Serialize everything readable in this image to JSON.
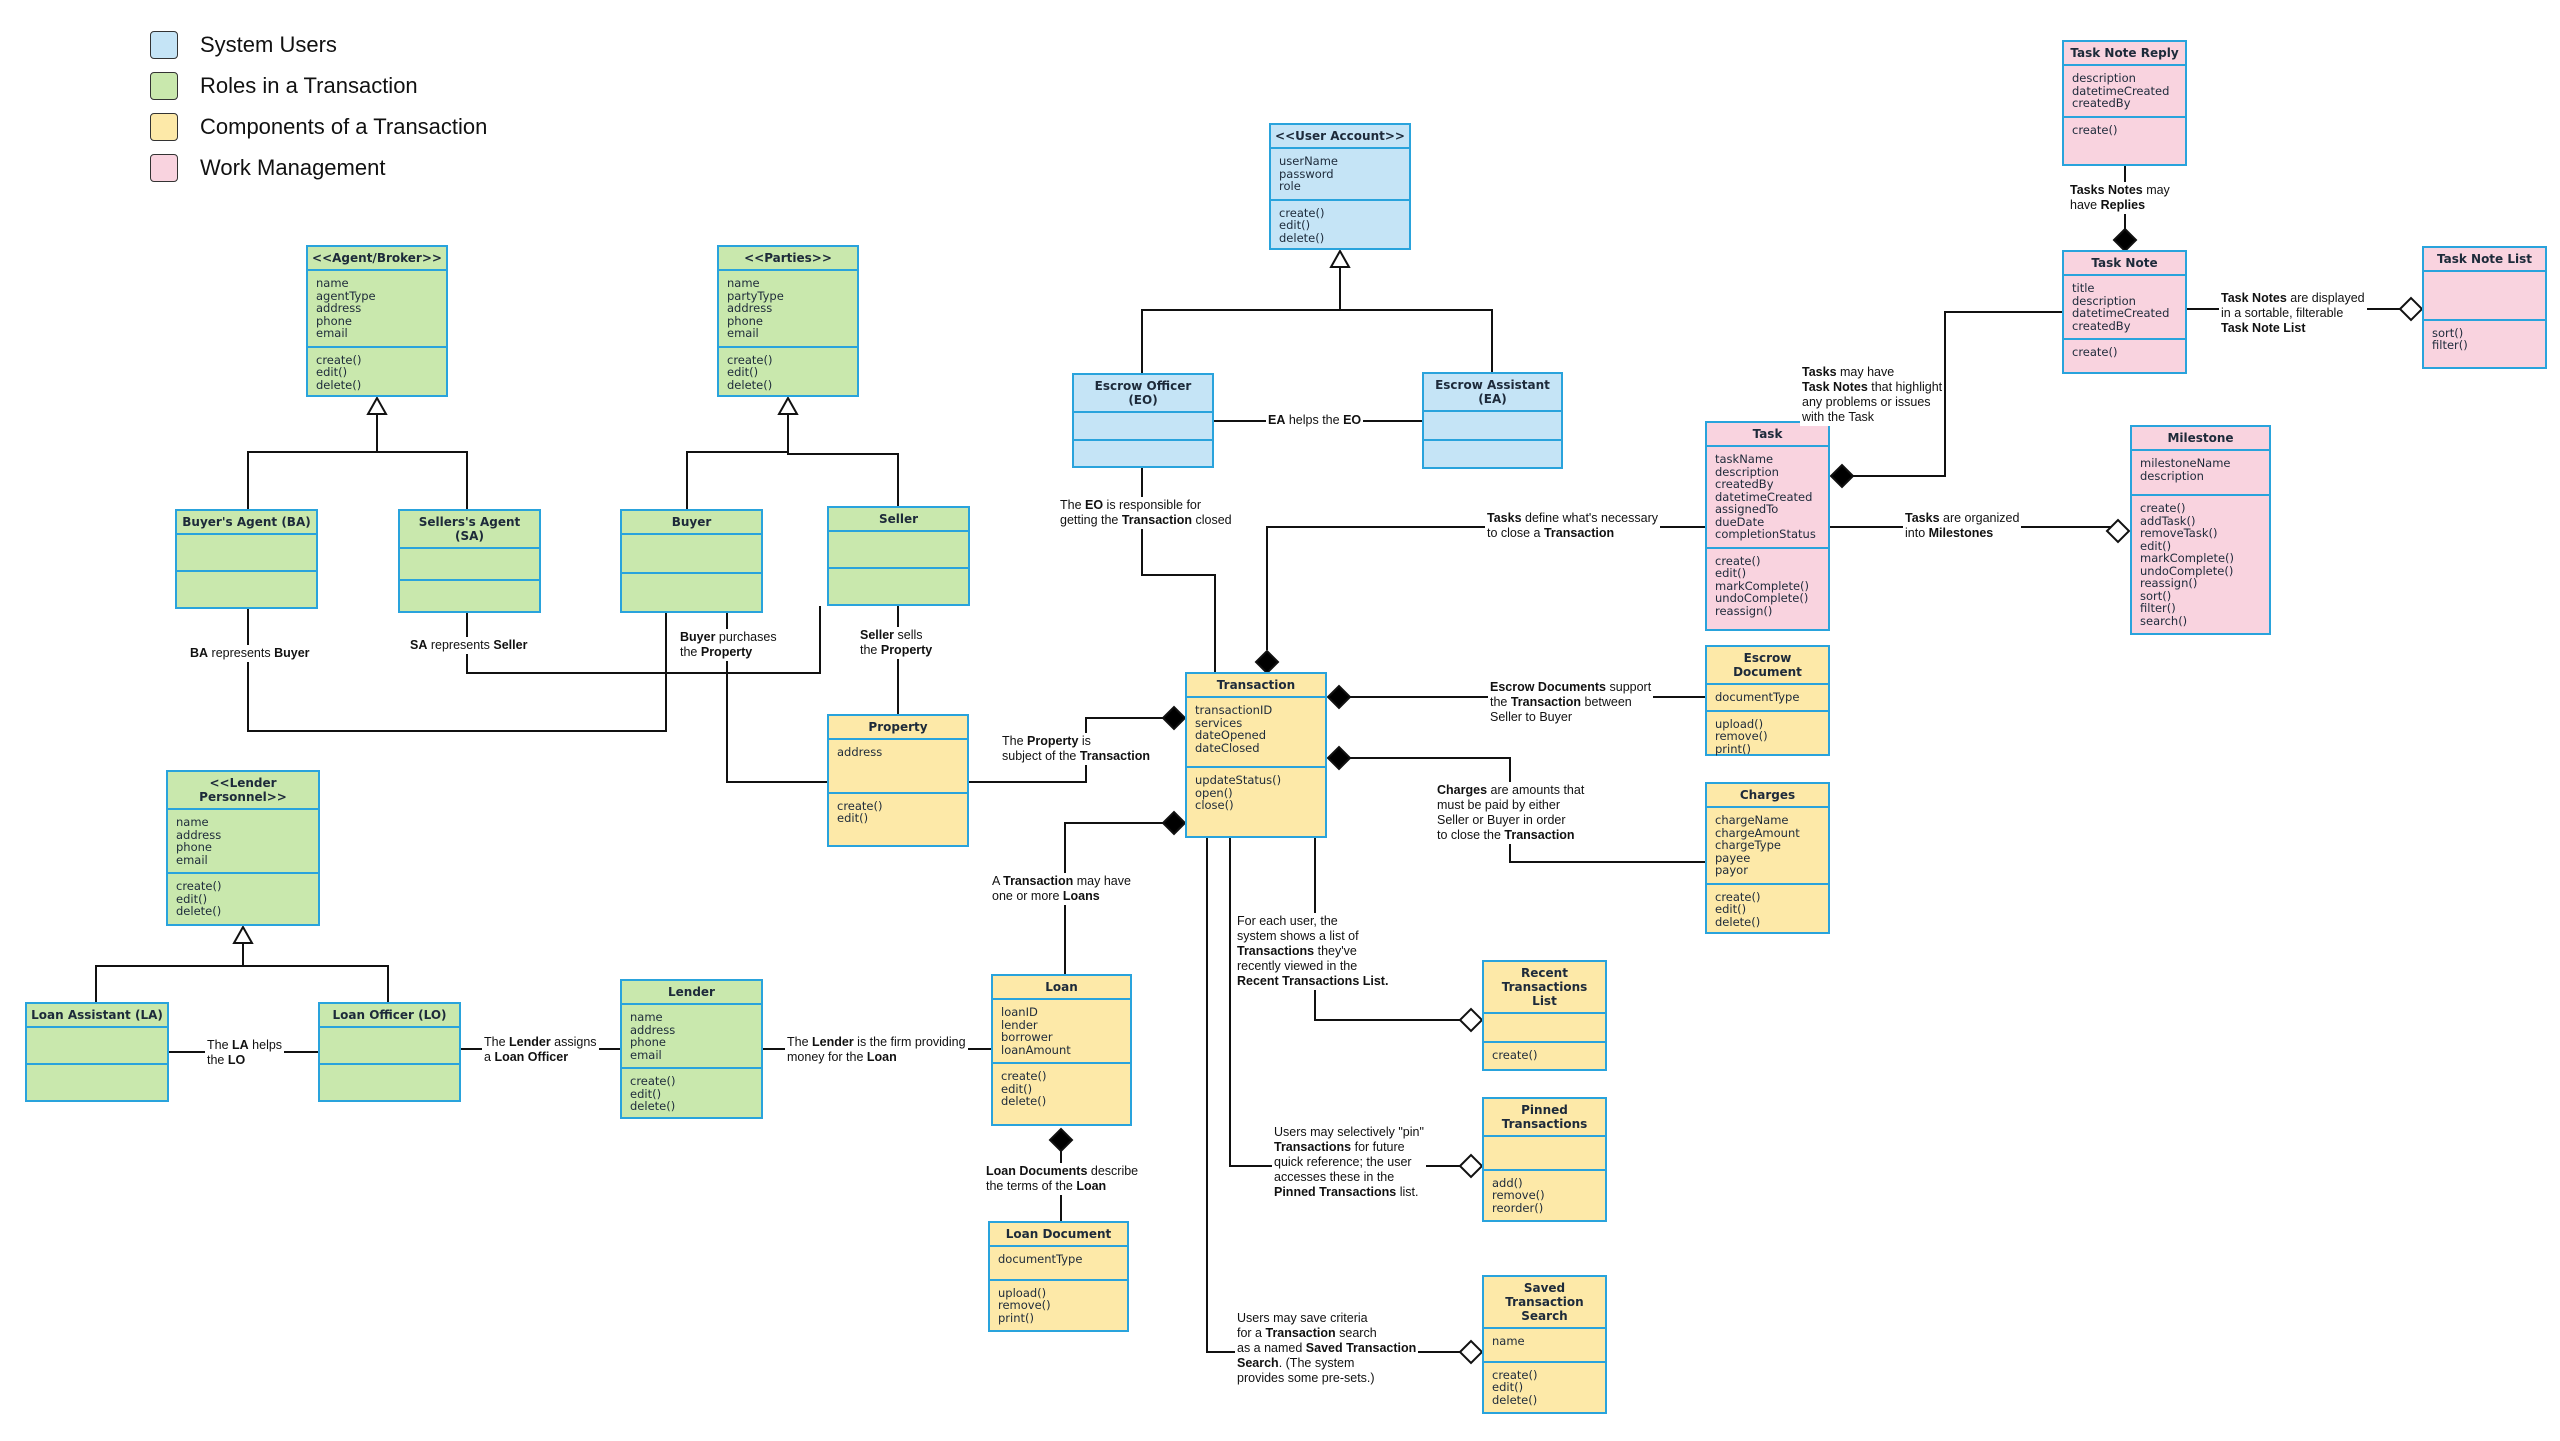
{
  "legend": [
    {
      "label": "System Users",
      "color": "#c5e4f6"
    },
    {
      "label": "Roles in a Transaction",
      "color": "#c9e8ad"
    },
    {
      "label": "Components of a Transaction",
      "color": "#fde9a8"
    },
    {
      "label": "Work Management",
      "color": "#f9d3df"
    }
  ],
  "classes": {
    "agent_broker": {
      "title": "<<Agent/Broker>>",
      "attributes": [
        "name",
        "agentType",
        "address",
        "phone",
        "email"
      ],
      "methods": [
        "create()",
        "edit()",
        "delete()"
      ]
    },
    "parties": {
      "title": "<<Parties>>",
      "attributes": [
        "name",
        "partyType",
        "address",
        "phone",
        "email"
      ],
      "methods": [
        "create()",
        "edit()",
        "delete()"
      ]
    },
    "buyers_agent": {
      "title": "Buyer's Agent (BA)"
    },
    "sellers_agent": {
      "title": "Sellers's Agent (SA)"
    },
    "buyer": {
      "title": "Buyer"
    },
    "seller": {
      "title": "Seller"
    },
    "user_account": {
      "title": "<<User Account>>",
      "attributes": [
        "userName",
        "password",
        "role"
      ],
      "methods": [
        "create()",
        "edit()",
        "delete()"
      ]
    },
    "escrow_officer": {
      "title": "Escrow Officer (EO)"
    },
    "escrow_assistant": {
      "title": "Escrow Assistant (EA)"
    },
    "property": {
      "title": "Property",
      "attributes": [
        "address"
      ],
      "methods": [
        "create()",
        "edit()"
      ]
    },
    "transaction": {
      "title": "Transaction",
      "attributes": [
        "transactionID",
        "services",
        "dateOpened",
        "dateClosed"
      ],
      "methods": [
        "updateStatus()",
        "open()",
        "close()"
      ]
    },
    "lender_personnel": {
      "title": "<<Lender Personnel>>",
      "attributes": [
        "name",
        "address",
        "phone",
        "email"
      ],
      "methods": [
        "create()",
        "edit()",
        "delete()"
      ]
    },
    "loan_assistant": {
      "title": "Loan Assistant (LA)"
    },
    "loan_officer": {
      "title": "Loan Officer (LO)"
    },
    "lender": {
      "title": "Lender",
      "attributes": [
        "name",
        "address",
        "phone",
        "email"
      ],
      "methods": [
        "create()",
        "edit()",
        "delete()"
      ]
    },
    "loan": {
      "title": "Loan",
      "attributes": [
        "loanID",
        "lender",
        "borrower",
        "loanAmount"
      ],
      "methods": [
        "create()",
        "edit()",
        "delete()"
      ]
    },
    "loan_document": {
      "title": "Loan Document",
      "attributes": [
        "documentType"
      ],
      "methods": [
        "upload()",
        "remove()",
        "print()"
      ]
    },
    "escrow_document": {
      "title": "Escrow Document",
      "attributes": [
        "documentType"
      ],
      "methods": [
        "upload()",
        "remove()",
        "print()"
      ]
    },
    "charges": {
      "title": "Charges",
      "attributes": [
        "chargeName",
        "chargeAmount",
        "chargeType",
        "payee",
        "payor"
      ],
      "methods": [
        "create()",
        "edit()",
        "delete()"
      ]
    },
    "recent_transactions_list": {
      "title": "Recent Transactions List",
      "attributes": [],
      "methods": [
        "create()"
      ]
    },
    "pinned_transactions": {
      "title": "Pinned Transactions",
      "attributes": [],
      "methods": [
        "add()",
        "remove()",
        "reorder()"
      ]
    },
    "saved_transaction_search": {
      "title": "Saved Transaction Search",
      "attributes": [
        "name"
      ],
      "methods": [
        "create()",
        "edit()",
        "delete()"
      ]
    },
    "task_note_reply": {
      "title": "Task Note Reply",
      "attributes": [
        "description",
        "datetimeCreated",
        "createdBy"
      ],
      "methods": [
        "create()"
      ]
    },
    "task_note": {
      "title": "Task Note",
      "attributes": [
        "title",
        "description",
        "datetimeCreated",
        "createdBy"
      ],
      "methods": [
        "create()"
      ]
    },
    "task_note_list": {
      "title": "Task Note List",
      "attributes": [],
      "methods": [
        "sort()",
        "filter()"
      ]
    },
    "task": {
      "title": "Task",
      "attributes": [
        "taskName",
        "description",
        "createdBy",
        "datetimeCreated",
        "assignedTo",
        "dueDate",
        "completionStatus"
      ],
      "methods": [
        "create()",
        "edit()",
        "markComplete()",
        "undoComplete()",
        "reassign()"
      ]
    },
    "milestone": {
      "title": "Milestone",
      "attributes": [
        "milestoneName",
        "description"
      ],
      "methods": [
        "create()",
        "addTask()",
        "removeTask()",
        "edit()",
        "markComplete()",
        "undoComplete()",
        "reassign()",
        "sort()",
        "filter()",
        "search()"
      ]
    }
  },
  "relationships": {
    "ba_buyer": [
      {
        "b": "BA"
      },
      {
        "t": " represents "
      },
      {
        "b": "Buyer"
      }
    ],
    "sa_seller": [
      {
        "b": "SA"
      },
      {
        "t": " represents "
      },
      {
        "b": "Seller"
      }
    ],
    "buyer_property": [
      {
        "b": "Buyer"
      },
      {
        "t": " purchases"
      },
      {
        "br": 1
      },
      {
        "t": "the "
      },
      {
        "b": "Property"
      }
    ],
    "seller_property": [
      {
        "b": "Seller"
      },
      {
        "t": " sells"
      },
      {
        "br": 1
      },
      {
        "t": "the "
      },
      {
        "b": "Property"
      }
    ],
    "ea_eo": [
      {
        "b": "EA"
      },
      {
        "t": " helps the "
      },
      {
        "b": "EO"
      }
    ],
    "eo_transaction": [
      {
        "t": "The "
      },
      {
        "b": "EO"
      },
      {
        "t": " is responsible for"
      },
      {
        "br": 1
      },
      {
        "t": "getting the "
      },
      {
        "b": "Transaction"
      },
      {
        "t": " closed"
      }
    ],
    "property_transaction": [
      {
        "t": "The "
      },
      {
        "b": "Property"
      },
      {
        "t": " is"
      },
      {
        "br": 1
      },
      {
        "t": "subject of the "
      },
      {
        "b": "Transaction"
      }
    ],
    "tasks_transaction": [
      {
        "b": "Tasks"
      },
      {
        "t": " define what's necessary"
      },
      {
        "br": 1
      },
      {
        "t": "to close a "
      },
      {
        "b": "Transaction"
      }
    ],
    "escrowdocs_transaction": [
      {
        "b": "Escrow Documents"
      },
      {
        "t": " support"
      },
      {
        "br": 1
      },
      {
        "t": "the "
      },
      {
        "b": "Transaction"
      },
      {
        "t": " between"
      },
      {
        "br": 1
      },
      {
        "t": "Seller to Buyer"
      }
    ],
    "charges_transaction": [
      {
        "b": "Charges"
      },
      {
        "t": " are amounts that"
      },
      {
        "br": 1
      },
      {
        "t": "must be paid by either"
      },
      {
        "br": 1
      },
      {
        "t": "Seller or Buyer in order"
      },
      {
        "br": 1
      },
      {
        "t": "to close the "
      },
      {
        "b": "Transaction"
      }
    ],
    "transaction_loans": [
      {
        "t": "A "
      },
      {
        "b": "Transaction"
      },
      {
        "t": " may have"
      },
      {
        "br": 1
      },
      {
        "t": "one or more "
      },
      {
        "b": "Loans"
      }
    ],
    "lender_loan": [
      {
        "t": "The "
      },
      {
        "b": "Lender"
      },
      {
        "t": " is the firm providing"
      },
      {
        "br": 1
      },
      {
        "t": "money for the "
      },
      {
        "b": "Loan"
      }
    ],
    "lender_lo": [
      {
        "t": "The "
      },
      {
        "b": "Lender"
      },
      {
        "t": " assigns"
      },
      {
        "br": 1
      },
      {
        "t": "a "
      },
      {
        "b": "Loan Officer"
      }
    ],
    "la_lo": [
      {
        "t": "The "
      },
      {
        "b": "LA"
      },
      {
        "t": " helps"
      },
      {
        "br": 1
      },
      {
        "t": "the "
      },
      {
        "b": "LO"
      }
    ],
    "loandocs_loan": [
      {
        "b": "Loan Documents"
      },
      {
        "t": " describe"
      },
      {
        "br": 1
      },
      {
        "t": "the terms of the "
      },
      {
        "b": "Loan"
      }
    ],
    "recent_list": [
      {
        "t": "For each user, the"
      },
      {
        "br": 1
      },
      {
        "t": "system shows a list of"
      },
      {
        "br": 1
      },
      {
        "b": "Transactions"
      },
      {
        "t": " they've"
      },
      {
        "br": 1
      },
      {
        "t": "recently viewed in the"
      },
      {
        "br": 1
      },
      {
        "b": "Recent Transactions List."
      }
    ],
    "pinned": [
      {
        "t": "Users may selectively \"pin\""
      },
      {
        "br": 1
      },
      {
        "b": "Transactions"
      },
      {
        "t": " for future"
      },
      {
        "br": 1
      },
      {
        "t": "quick reference; the user"
      },
      {
        "br": 1
      },
      {
        "t": "accesses these in the"
      },
      {
        "br": 1
      },
      {
        "b": "Pinned Transactions"
      },
      {
        "t": " list."
      }
    ],
    "saved_search": [
      {
        "t": "Users may save criteria"
      },
      {
        "br": 1
      },
      {
        "t": "for a "
      },
      {
        "b": "Transaction"
      },
      {
        "t": " search"
      },
      {
        "br": 1
      },
      {
        "t": "as a named "
      },
      {
        "b": "Saved Transaction"
      },
      {
        "br": 1
      },
      {
        "b": "Search"
      },
      {
        "t": ". (The system"
      },
      {
        "br": 1
      },
      {
        "t": "provides some pre-sets.)"
      }
    ],
    "tasks_milestones": [
      {
        "b": "Tasks"
      },
      {
        "t": " are organized"
      },
      {
        "br": 1
      },
      {
        "t": "into "
      },
      {
        "b": "Milestones"
      }
    ],
    "tasks_notes": [
      {
        "b": "Tasks"
      },
      {
        "t": " may have"
      },
      {
        "br": 1
      },
      {
        "b": "Task Notes"
      },
      {
        "t": " that highlight"
      },
      {
        "br": 1
      },
      {
        "t": "any problems or issues"
      },
      {
        "br": 1
      },
      {
        "t": "with the Task"
      }
    ],
    "notes_replies": [
      {
        "b": "Tasks Notes"
      },
      {
        "t": " may"
      },
      {
        "br": 1
      },
      {
        "t": "have "
      },
      {
        "b": "Replies"
      }
    ],
    "notes_list": [
      {
        "b": "Task Notes"
      },
      {
        "t": " are displayed"
      },
      {
        "br": 1
      },
      {
        "t": "in a sortable, filterable"
      },
      {
        "br": 1
      },
      {
        "b": "Task Note List"
      }
    ]
  }
}
